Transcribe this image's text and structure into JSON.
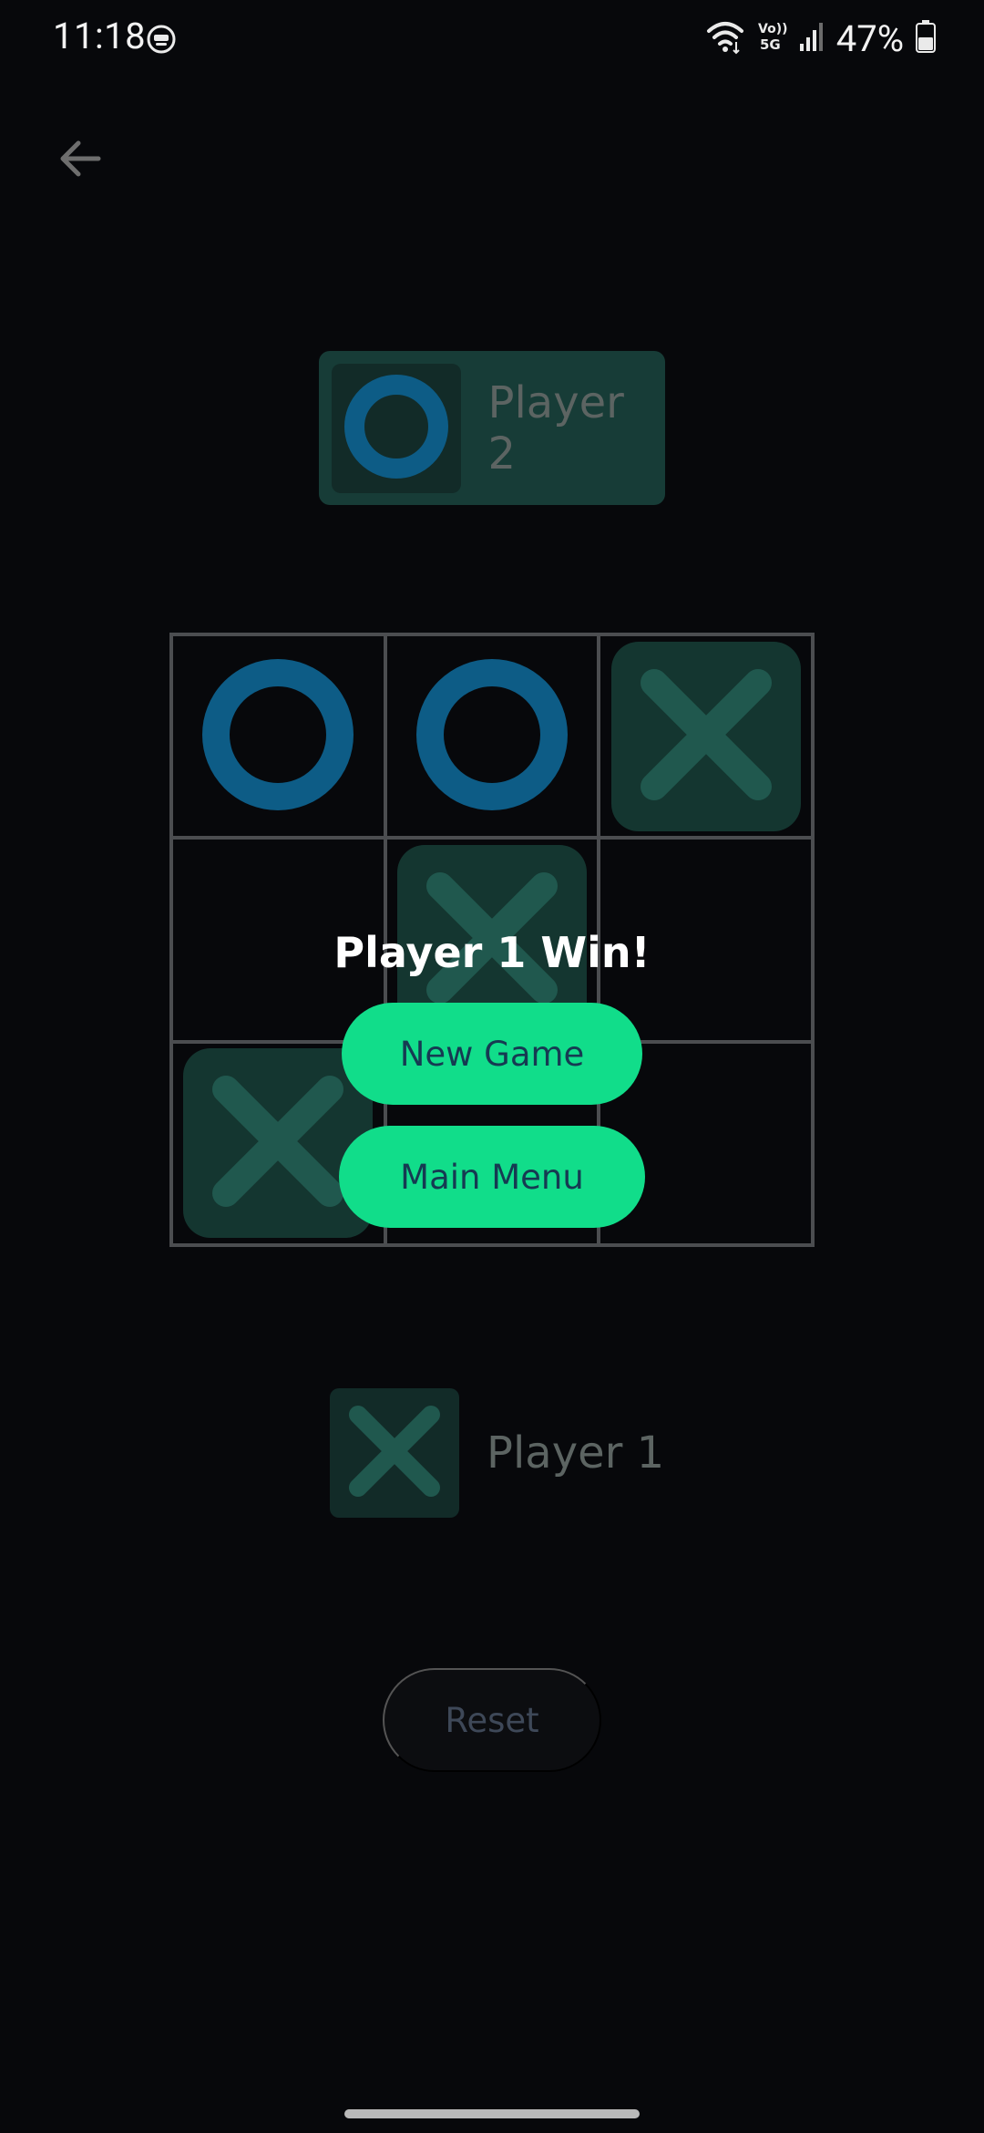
{
  "status_bar": {
    "time": "11:18",
    "battery_percent": "47%",
    "icons": [
      "wifi-icon",
      "volte-5g-icon",
      "signal-icon",
      "battery-icon"
    ]
  },
  "header": {
    "back_icon": "arrow-left-icon"
  },
  "players": {
    "top": {
      "label": "Player 2",
      "mark": "O",
      "active": true
    },
    "bottom": {
      "label": "Player 1",
      "mark": "X",
      "active": false
    }
  },
  "board": {
    "cells": [
      "O",
      "O",
      "X",
      "",
      "X",
      "",
      "X",
      "",
      ""
    ]
  },
  "overlay": {
    "title": "Player 1 Win!",
    "new_game_label": "New Game",
    "main_menu_label": "Main Menu"
  },
  "footer": {
    "reset_label": "Reset"
  },
  "colors": {
    "background": "#07080b",
    "accent_green": "#11dd8a",
    "o_mark": "#0d5c86",
    "x_mark": "#20584e",
    "grid_line": "#4b4d50"
  }
}
